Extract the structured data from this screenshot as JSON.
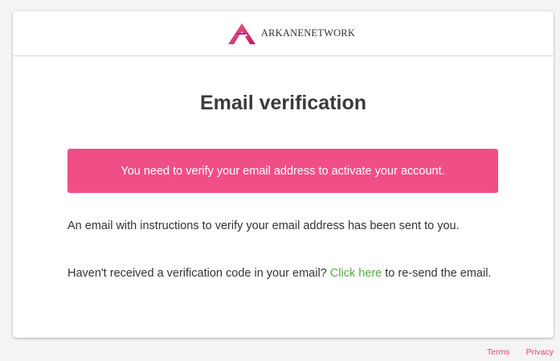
{
  "header": {
    "brand_name": "ArkaneNetwork",
    "logo_icon": "arkane-logo-icon"
  },
  "main": {
    "title": "Email verification",
    "alert_text": "You need to verify your email address to activate your account.",
    "info_text": "An email with instructions to verify your email address has been sent to you.",
    "resend_prefix": "Haven't received a verification code in your email? ",
    "resend_link": "Click here",
    "resend_suffix": " to re-send the email."
  },
  "footer": {
    "terms": "Terms",
    "privacy": "Privacy"
  },
  "colors": {
    "alert_background": "#f04e87",
    "link": "#5aa845",
    "footer_link": "#e8427c",
    "logo_gradient_start": "#f06292",
    "logo_gradient_end": "#9c27b0"
  }
}
